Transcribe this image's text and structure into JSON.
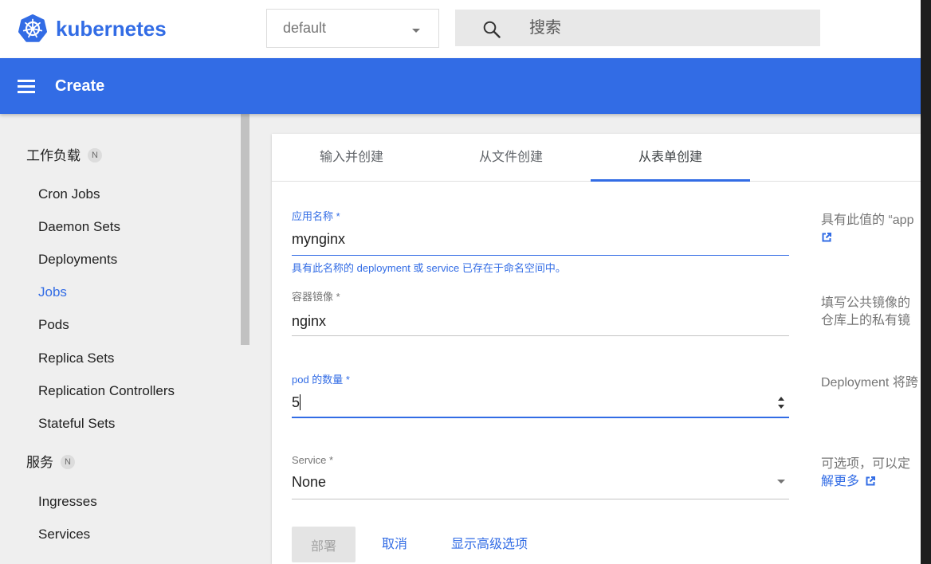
{
  "header": {
    "logo_icon": "kubernetes-logo",
    "brand": "kubernetes",
    "namespace": {
      "value": "default",
      "icon": "chevron-down-icon"
    },
    "search": {
      "placeholder": "搜索",
      "icon": "search-icon"
    }
  },
  "toolbar": {
    "menu_icon": "menu-icon",
    "title": "Create"
  },
  "sidebar": {
    "sections": [
      {
        "title": "工作负载",
        "badge": "N",
        "items": [
          {
            "label": "Cron Jobs"
          },
          {
            "label": "Daemon Sets"
          },
          {
            "label": "Deployments"
          },
          {
            "label": "Jobs",
            "active": true
          },
          {
            "label": "Pods"
          },
          {
            "label": "Replica Sets"
          },
          {
            "label": "Replication Controllers"
          },
          {
            "label": "Stateful Sets"
          }
        ]
      },
      {
        "title": "服务",
        "badge": "N",
        "items": [
          {
            "label": "Ingresses"
          },
          {
            "label": "Services"
          }
        ]
      }
    ]
  },
  "create": {
    "tabs": [
      {
        "label": "输入并创建"
      },
      {
        "label": "从文件创建"
      },
      {
        "label": "从表单创建",
        "active": true
      }
    ],
    "form": {
      "app_name": {
        "label": "应用名称 *",
        "value": "mynginx",
        "error": "具有此名称的 deployment 或 service 已存在于命名空间中。"
      },
      "container_image": {
        "label": "容器镜像 *",
        "value": "nginx"
      },
      "pod_count": {
        "label": "pod 的数量 *",
        "value": "5",
        "icon": "number-stepper-icon"
      },
      "service": {
        "label": "Service *",
        "value": "None",
        "icon": "dropdown-arrow-icon"
      }
    },
    "help": {
      "app_name": {
        "lines": [
          "具有此值的 “app"
        ],
        "icon": "external-link-icon"
      },
      "container_image": {
        "lines": [
          "填写公共镜像的",
          "仓库上的私有镜"
        ]
      },
      "pod_count": {
        "lines": [
          "Deployment 将跨"
        ]
      },
      "service": {
        "lines": [
          "可选项，可以定"
        ],
        "link": "解更多",
        "icon": "external-link-icon"
      }
    },
    "actions": {
      "deploy": "部署",
      "cancel": "取消",
      "advanced": "显示高级选项"
    }
  },
  "colors": {
    "primary": "#326ce5",
    "background": "#efefef",
    "card": "#ffffff",
    "muted_text": "#757575",
    "disabled_button": "#e4e4e4"
  }
}
